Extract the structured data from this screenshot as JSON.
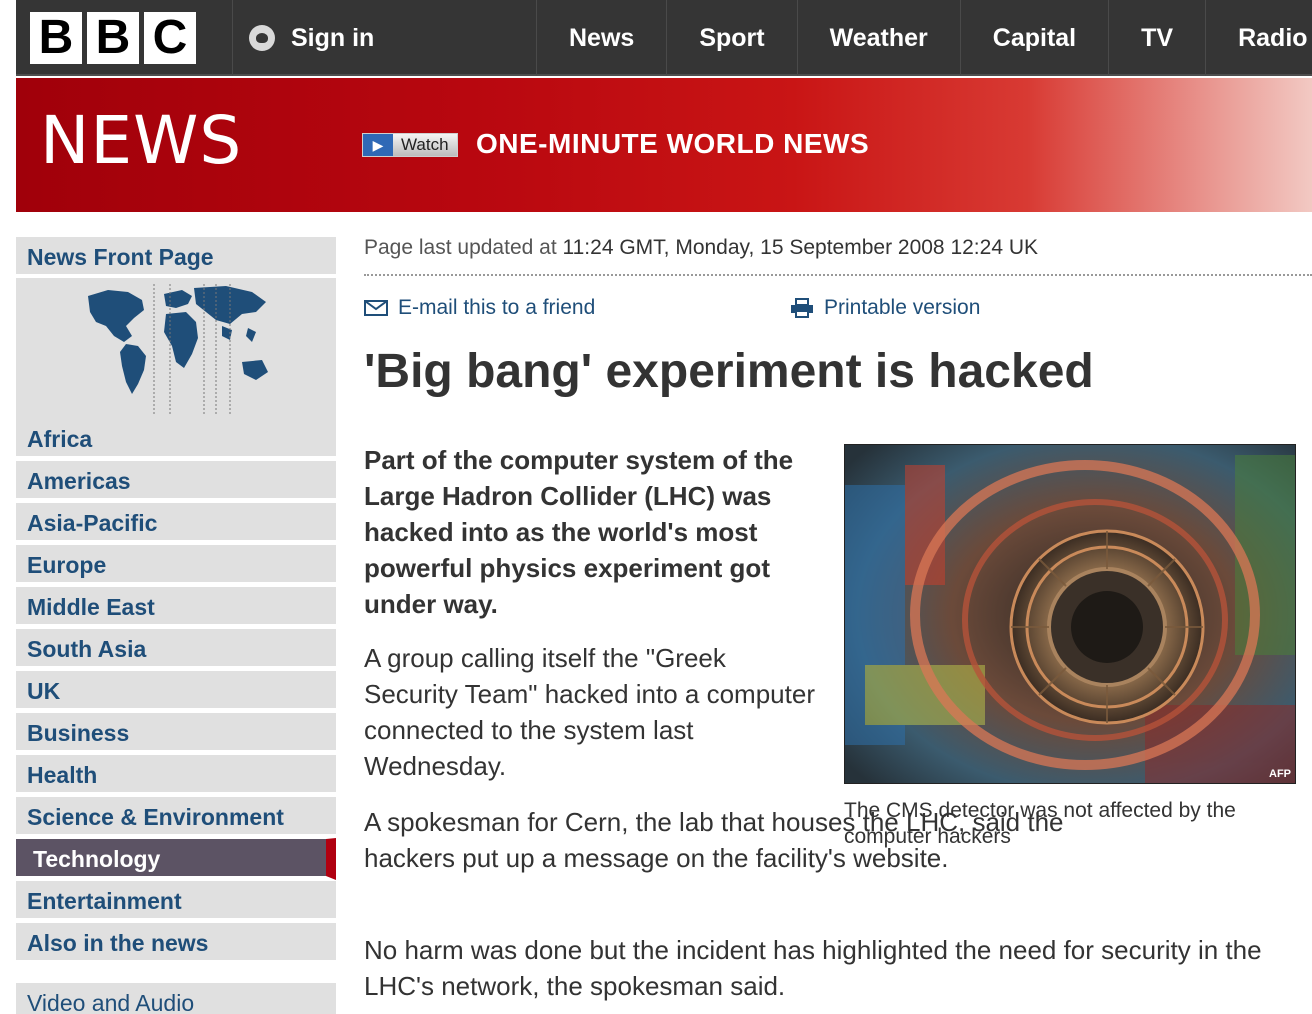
{
  "header": {
    "logo_letters": [
      "B",
      "B",
      "C"
    ],
    "signin_label": "Sign in",
    "nav": [
      "News",
      "Sport",
      "Weather",
      "Capital",
      "TV",
      "Radio"
    ]
  },
  "banner": {
    "section_title": "NEWS",
    "watch_label": "Watch",
    "headline": "ONE-MINUTE WORLD NEWS"
  },
  "sidebar": {
    "front_page": "News Front Page",
    "items": [
      "Africa",
      "Americas",
      "Asia-Pacific",
      "Europe",
      "Middle East",
      "South Asia",
      "UK",
      "Business",
      "Health",
      "Science & Environment",
      "Technology",
      "Entertainment",
      "Also in the news"
    ],
    "active_item": "Technology",
    "video_audio": "Video and Audio"
  },
  "article": {
    "updated_prefix": "Page last updated at ",
    "updated_time": "11:24 GMT, Monday, 15 September 2008 12:24 UK",
    "email_label": "E-mail this to a friend",
    "print_label": "Printable version",
    "headline": "'Big bang' experiment is hacked",
    "lead": "Part of the computer system of the Large Hadron Collider (LHC) was hacked into as the world's most powerful physics experiment got under way.",
    "p1": "A group calling itself the \"Greek Security Team\" hacked into a computer connected to the system last Wednesday.",
    "p2": "A spokesman for Cern, the lab that houses the LHC, said the hackers put up a message on the facility's website.",
    "p3": "No harm was done but the incident has highlighted the need for security in the LHC's network, the spokesman said.",
    "image_credit": "AFP",
    "caption": "The CMS detector was not affected by the computer hackers"
  },
  "colors": {
    "topbar": "#353535",
    "banner_red": "#b8070f",
    "sidebar_bg": "#e0e0e0",
    "link_blue": "#1f4e79",
    "active_bg": "#5c5364"
  }
}
